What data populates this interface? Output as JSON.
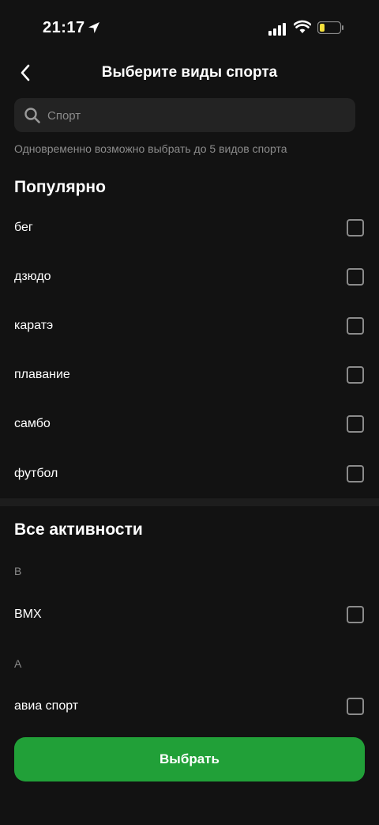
{
  "status": {
    "time": "21:17"
  },
  "header": {
    "title": "Выберите виды спорта"
  },
  "search": {
    "placeholder": "Спорт",
    "value": ""
  },
  "hint": "Одновременно возможно выбрать до 5 видов спорта",
  "popular": {
    "title": "Популярно",
    "items": [
      {
        "label": "бег",
        "checked": false
      },
      {
        "label": "дзюдо",
        "checked": false
      },
      {
        "label": "каратэ",
        "checked": false
      },
      {
        "label": "плавание",
        "checked": false
      },
      {
        "label": "самбо",
        "checked": false
      },
      {
        "label": "футбол",
        "checked": false
      }
    ]
  },
  "all": {
    "title": "Все активности",
    "groups": [
      {
        "letter": "B",
        "items": [
          {
            "label": "BMX",
            "checked": false
          }
        ]
      },
      {
        "letter": "А",
        "items": [
          {
            "label": "авиа спорт",
            "checked": false
          }
        ]
      }
    ]
  },
  "cta": {
    "label": "Выбрать"
  },
  "colors": {
    "background": "#121212",
    "accent": "#21a038",
    "battery_level": "#f5e03b"
  }
}
